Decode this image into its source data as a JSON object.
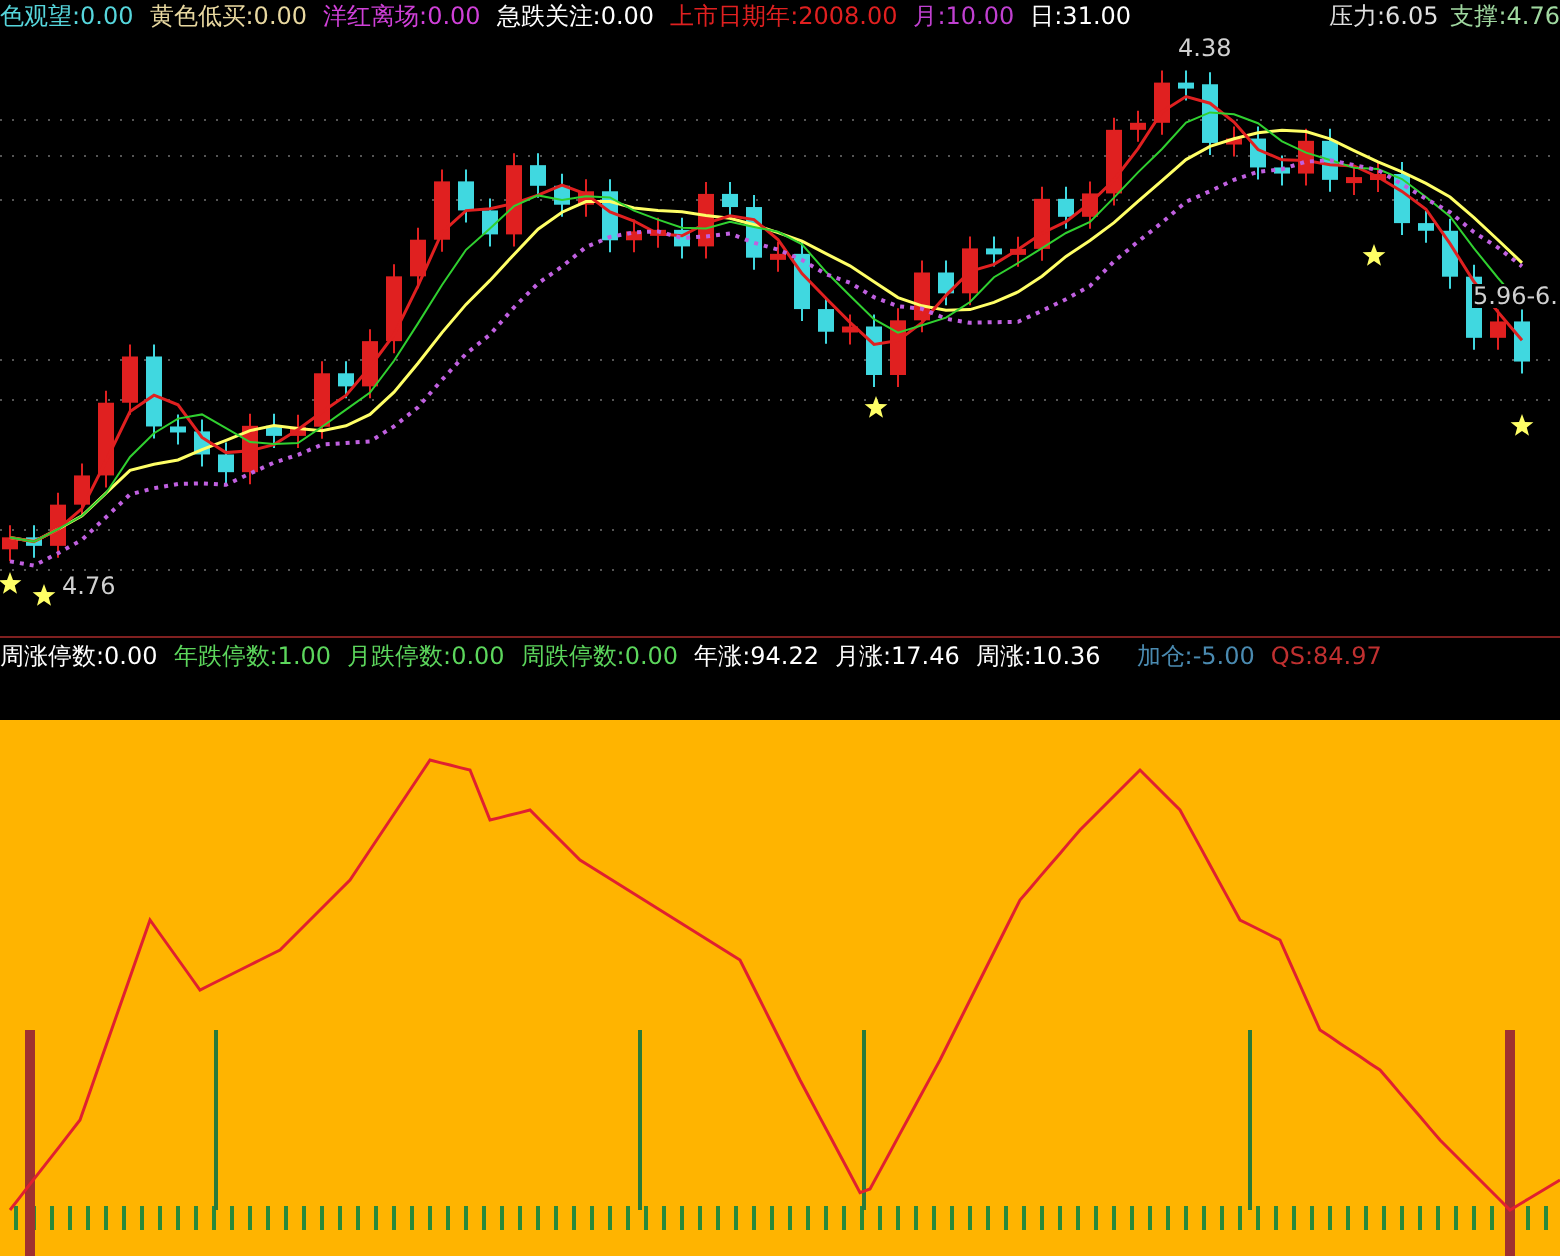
{
  "top_indicators": [
    {
      "text": "色观望:0.00",
      "color": "#56d6dc"
    },
    {
      "text": "黄色低买:0.00",
      "color": "#e8d8a0"
    },
    {
      "text": "洋红离场:0.00",
      "color": "#d040d8"
    },
    {
      "text": "急跌关注:0.00",
      "color": "#ffffff"
    },
    {
      "text": "上市日期年:2008.00",
      "color": "#e02020"
    },
    {
      "text": "月:10.00",
      "color": "#c040d0"
    },
    {
      "text": "日:31.00",
      "color": "#ffffff"
    }
  ],
  "levels": [
    {
      "text": "压力:6.05",
      "color": "#e0e0e0"
    },
    {
      "text": "支撑:4.76",
      "color": "#a0d8a0"
    }
  ],
  "price_labels": [
    "4.76",
    "4.38",
    "5.96-6."
  ],
  "bottom_indicators": [
    {
      "text": "周涨停数:0.00",
      "color": "#ffffff"
    },
    {
      "text": "年跌停数:1.00",
      "color": "#5cd65c"
    },
    {
      "text": "月跌停数:0.00",
      "color": "#5cd65c"
    },
    {
      "text": "周跌停数:0.00",
      "color": "#5cd65c"
    },
    {
      "text": "年涨:94.22",
      "color": "#ffffff"
    },
    {
      "text": "月涨:17.46",
      "color": "#ffffff"
    },
    {
      "text": "周涨:10.36",
      "color": "#ffffff"
    },
    {
      "text": "加仓:-5.00",
      "color": "#4a8ab0"
    },
    {
      "text": "QS:84.97",
      "color": "#c03030"
    }
  ]
}
